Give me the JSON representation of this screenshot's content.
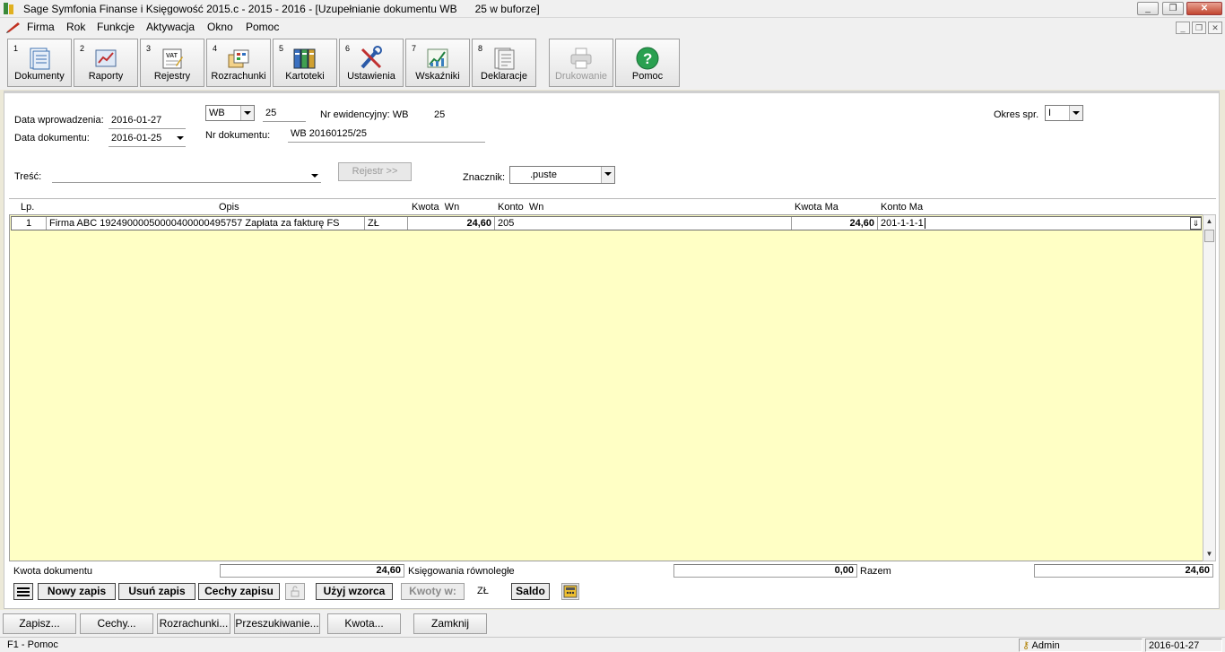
{
  "window": {
    "title": "Sage Symfonia Finanse i Księgowość 2015.c - 2015 - 2016 - [Uzupełnianie dokumentu WB      25 w buforze]",
    "controls": {
      "minimize": "_",
      "restore": "❐",
      "close": "✕"
    }
  },
  "menu": {
    "items": [
      "Firma",
      "Rok",
      "Funkcje",
      "Aktywacja",
      "Okno",
      "Pomoc"
    ]
  },
  "toolbar": {
    "buttons": [
      {
        "num": "1",
        "label": "Dokumenty",
        "icon": "documents-icon"
      },
      {
        "num": "2",
        "label": "Raporty",
        "icon": "reports-icon"
      },
      {
        "num": "3",
        "label": "Rejestry",
        "icon": "vat-registers-icon"
      },
      {
        "num": "4",
        "label": "Rozrachunki",
        "icon": "settlements-icon"
      },
      {
        "num": "5",
        "label": "Kartoteki",
        "icon": "records-icon"
      },
      {
        "num": "6",
        "label": "Ustawienia",
        "icon": "settings-tools-icon"
      },
      {
        "num": "7",
        "label": "Wskaźniki",
        "icon": "indicators-icon"
      },
      {
        "num": "8",
        "label": "Deklaracje",
        "icon": "declarations-icon"
      },
      {
        "num": "",
        "label": "Drukowanie",
        "icon": "printer-icon",
        "disabled": true
      },
      {
        "num": "",
        "label": "Pomoc",
        "icon": "help-icon"
      }
    ]
  },
  "form": {
    "data_wprowadzenia_label": "Data wprowadzenia:",
    "data_wprowadzenia": "2016-01-27",
    "data_dokumentu_label": "Data dokumentu:",
    "data_dokumentu": "2016-01-25",
    "typ": "WB",
    "numer": "25",
    "nr_ewidencyjny_label": "Nr ewidencyjny: WB",
    "nr_ewidencyjny": "25",
    "nr_dokumentu_label": "Nr dokumentu:",
    "nr_dokumentu": "WB 20160125/25",
    "okres_label": "Okres spr.",
    "okres": "I",
    "tresc_label": "Treść:",
    "tresc": "",
    "rejestr_button": "Rejestr >>",
    "znacznik_label": "Znacznik:",
    "znacznik": ".puste"
  },
  "grid": {
    "columns": [
      "Lp.",
      "Opis",
      "Kwota  Wn",
      "Konto  Wn",
      "Kwota Ma",
      "Konto Ma"
    ],
    "rows": [
      {
        "lp": "1",
        "opis": "Firma ABC 19249000050000400000495757 Zapłata za fakturę FS",
        "waluta": "ZŁ",
        "kwota_wn": "24,60",
        "konto_wn": "205",
        "kwota_ma": "24,60",
        "konto_ma": "201-1-1-1"
      }
    ]
  },
  "totals": {
    "kwota_dokumentu_label": "Kwota dokumentu",
    "kwota_dokumentu": "24,60",
    "ksiegowania_label": "Księgowania równoległe",
    "ksiegowania": "0,00",
    "razem_label": "Razem",
    "razem": "24,60"
  },
  "grid_actions": {
    "nowy_zapis": "Nowy zapis",
    "usun_zapis": "Usuń zapis",
    "cechy_zapisu": "Cechy zapisu",
    "uzyj_wzorca": "Użyj wzorca",
    "kwoty_w": "Kwoty w:",
    "waluta": "ZŁ",
    "saldo": "Saldo"
  },
  "actions": [
    "Zapisz...",
    "Cechy...",
    "Rozrachunki...",
    "Przeszukiwanie...",
    "Kwota...",
    "Zamknij"
  ],
  "status": {
    "help": "F1 - Pomoc",
    "user": "Admin",
    "date": "2016-01-27"
  }
}
